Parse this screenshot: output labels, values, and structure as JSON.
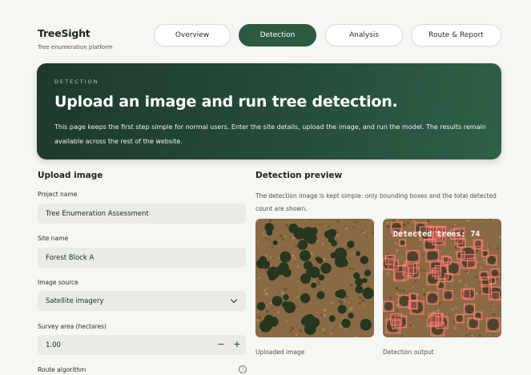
{
  "brand": {
    "title": "TreeSight",
    "subtitle": "Tree enumeration platform"
  },
  "nav": {
    "tabs": [
      {
        "label": "Overview",
        "active": false
      },
      {
        "label": "Detection",
        "active": true
      },
      {
        "label": "Analysis",
        "active": false
      },
      {
        "label": "Route & Report",
        "active": false
      }
    ]
  },
  "hero": {
    "eyebrow": "DETECTION",
    "title": "Upload an image and run tree detection.",
    "description": "This page keeps the first step simple for normal users. Enter the site details, upload the image, and run the model. The results remain available across the rest of the website."
  },
  "upload": {
    "title": "Upload image",
    "project_name": {
      "label": "Project name",
      "value": "Tree Enumeration Assessment"
    },
    "site_name": {
      "label": "Site name",
      "value": "Forest Block A"
    },
    "image_source": {
      "label": "Image source",
      "value": "Satellite imagery"
    },
    "survey_area": {
      "label": "Survey area (hectares)",
      "value": "1.00",
      "minus": "−",
      "plus": "+"
    },
    "route_algorithm": {
      "label": "Route algorithm",
      "help": "?"
    }
  },
  "preview": {
    "title": "Detection preview",
    "description": "The detection image is kept simple: only bounding boxes and the total detected count are shown.",
    "uploaded_caption": "Uploaded image",
    "output_caption": "Detection output",
    "overlay_text": "Detected trees: 74",
    "detected_count": 74
  },
  "colors": {
    "accent": "#2b5a43",
    "hero_start": "#1d3a2c",
    "hero_end": "#2f6048",
    "box_outline": "#ff7a6e",
    "field_bg": "#e8ece4"
  },
  "icons": {
    "chevron": "chevron-down-icon",
    "help": "help-circle-icon"
  }
}
